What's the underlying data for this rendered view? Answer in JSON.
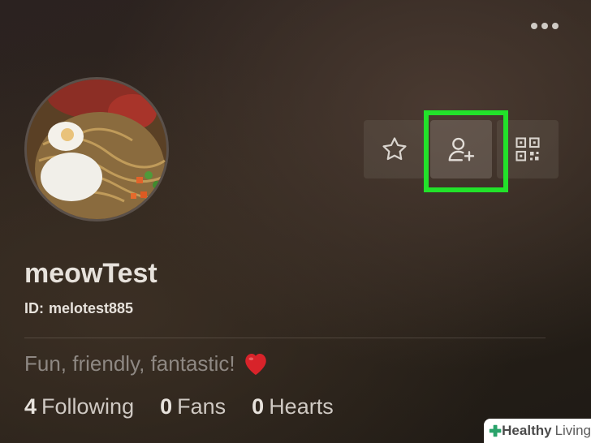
{
  "header": {
    "more_icon": "ellipsis-horizontal-icon"
  },
  "profile": {
    "username": "meowTest",
    "id_label": "ID:",
    "id_value": "melotest885",
    "bio": "Fun, friendly, fantastic!",
    "bio_emoji": "heart-emoji"
  },
  "actions": [
    {
      "icon": "star-icon",
      "label": "favorite"
    },
    {
      "icon": "add-friend-icon",
      "label": "follow"
    },
    {
      "icon": "qr-code-icon",
      "label": "qr code"
    }
  ],
  "stats": [
    {
      "num": "4",
      "label": "Following"
    },
    {
      "num": "0",
      "label": "Fans"
    },
    {
      "num": "0",
      "label": "Hearts"
    }
  ],
  "watermark": {
    "part1": "Healthy",
    "part2": "Living"
  },
  "colors": {
    "highlight": "#22e22a",
    "heart": "#d8232a"
  }
}
